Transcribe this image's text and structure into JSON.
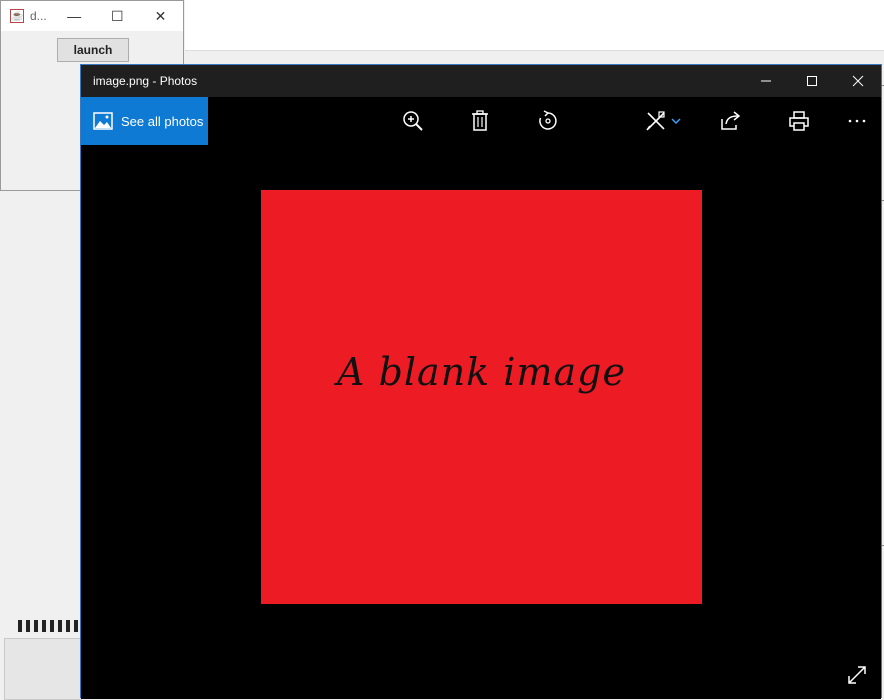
{
  "launcher": {
    "title": "d...",
    "minimize_glyph": "—",
    "maximize_glyph": "☐",
    "close_glyph": "✕",
    "launch_label": "launch"
  },
  "photos": {
    "title": "image.png - Photos",
    "see_all_label": "See all photos",
    "image_text": "A blank image",
    "image_color": "#ed1c24",
    "accent": "#0e7ad4",
    "toolbar_icons": [
      "zoom-in-icon",
      "delete-icon",
      "rotate-icon",
      "edit-draw-icon",
      "share-icon",
      "print-icon",
      "more-icon"
    ]
  }
}
